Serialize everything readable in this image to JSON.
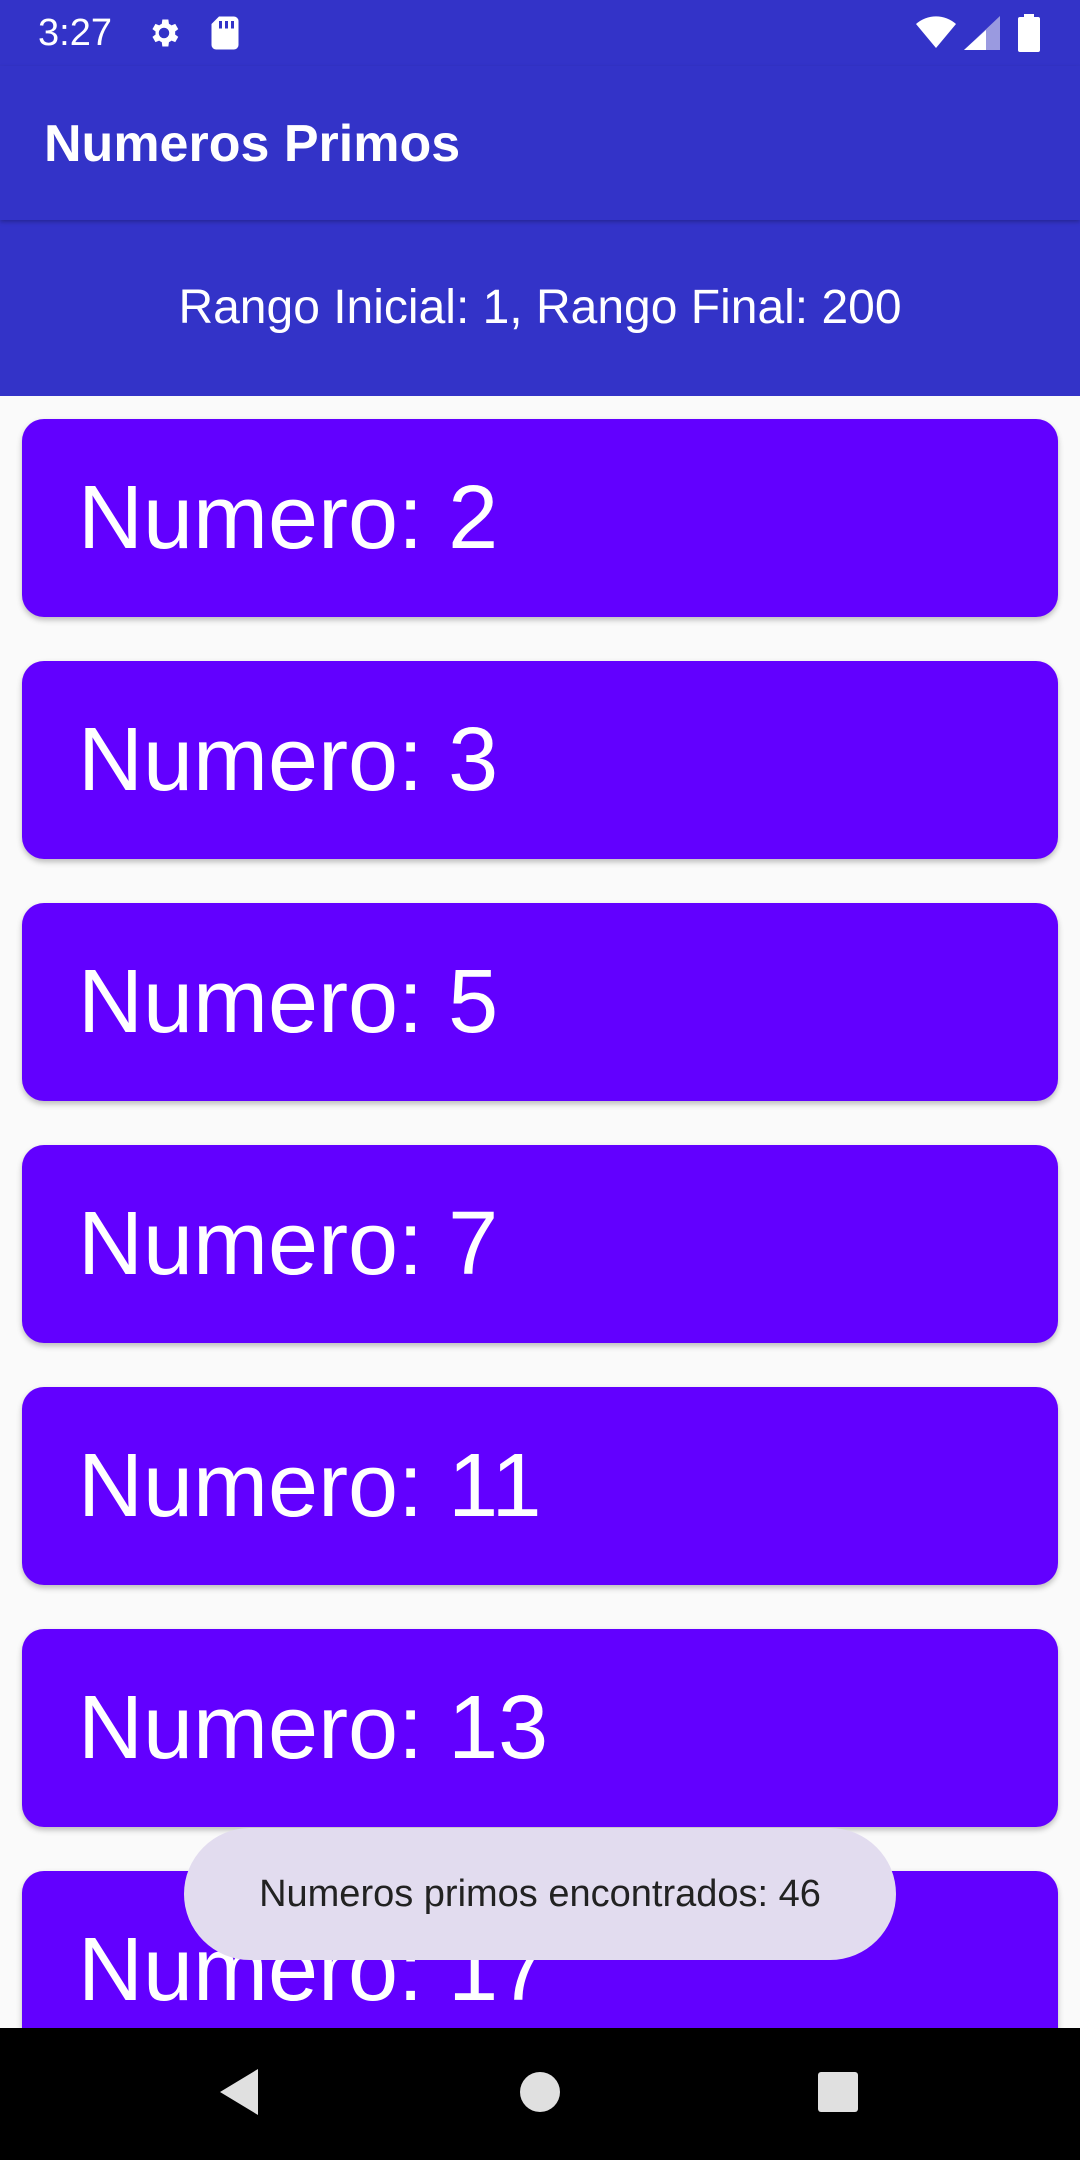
{
  "status_bar": {
    "time": "3:27",
    "icons": [
      "gear-icon",
      "sd-card-icon",
      "wifi-icon",
      "signal-icon",
      "battery-icon"
    ]
  },
  "app_bar": {
    "title": "Numeros Primos"
  },
  "range": {
    "text": "Rango Inicial: 1, Rango Final: 200"
  },
  "list": {
    "items": [
      {
        "label": "Numero: 2"
      },
      {
        "label": "Numero: 3"
      },
      {
        "label": "Numero: 5"
      },
      {
        "label": "Numero: 7"
      },
      {
        "label": "Numero: 11"
      },
      {
        "label": "Numero: 13"
      },
      {
        "label": "Numero: 17"
      }
    ]
  },
  "toast": {
    "text": "Numeros primos encontrados: 46"
  },
  "nav_bar": {
    "buttons": [
      "back-icon",
      "home-icon",
      "recents-icon"
    ]
  },
  "colors": {
    "primary": "#3333c8",
    "card": "#6200ff",
    "toast_bg": "#e2dcef",
    "background": "#fafafa"
  }
}
